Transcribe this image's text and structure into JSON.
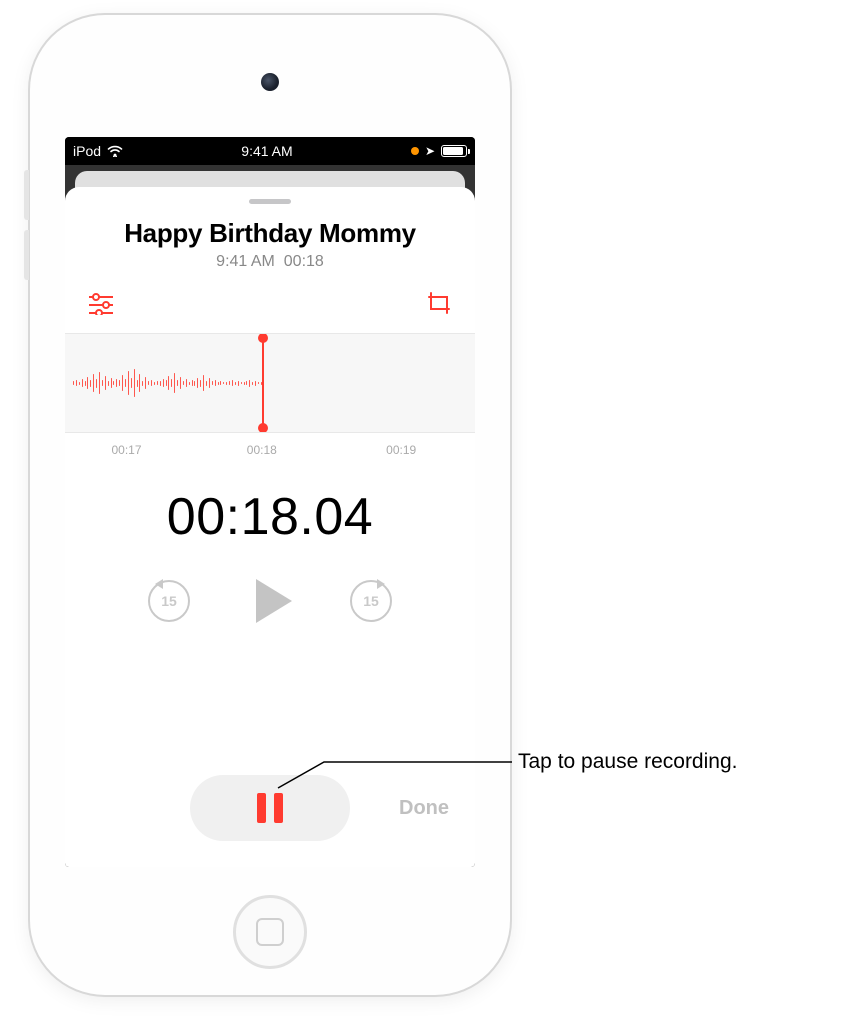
{
  "statusBar": {
    "carrier": "iPod",
    "time": "9:41 AM"
  },
  "recording": {
    "title": "Happy Birthday Mommy",
    "subtitle_time": "9:41 AM",
    "subtitle_duration": "00:18",
    "timer": "00:18.04",
    "skipSeconds": "15",
    "doneLabel": "Done"
  },
  "timeline": {
    "ticks": [
      "00:17",
      "00:18",
      "00:19"
    ]
  },
  "callout": {
    "text": "Tap to pause recording."
  }
}
